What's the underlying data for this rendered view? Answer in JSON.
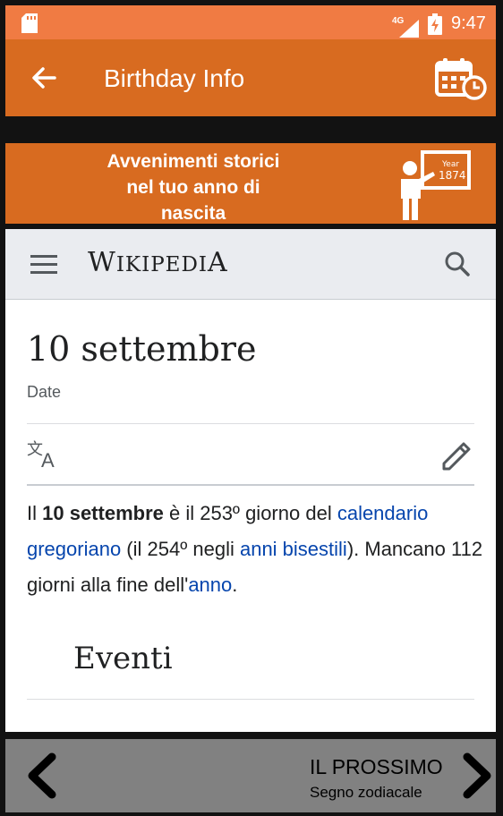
{
  "status_bar": {
    "network": "4G",
    "time": "9:47"
  },
  "app_bar": {
    "title": "Birthday Info",
    "back_icon": "arrow-left-icon",
    "action_icon": "calendar-clock-icon"
  },
  "banner": {
    "text": "Avvenimenti storici nel tuo anno di nascita",
    "board_text": [
      "Year",
      "1874"
    ]
  },
  "wiki": {
    "logo_first": "W",
    "logo_rest": "IKIPEDI",
    "logo_last": "A",
    "title": "10 settembre",
    "description": "Date",
    "para": {
      "t1": "Il ",
      "bold": "10 settembre",
      "t2": " è il 253º giorno del ",
      "link1": "calendario gregoriano",
      "t3": " (il 254º negli ",
      "link2": "anni bisestili",
      "t4": "). Mancano 112 giorni alla fine dell'",
      "link3": "anno",
      "t5": "."
    },
    "section_title": "Eventi"
  },
  "bottom_bar": {
    "next_title": "IL PROSSIMO",
    "next_subtitle": "Segno zodiacale"
  },
  "colors": {
    "status_bar": "#f07b43",
    "app_bar": "#d86b20",
    "link": "#0645ad",
    "bottom_bar": "#818181"
  }
}
